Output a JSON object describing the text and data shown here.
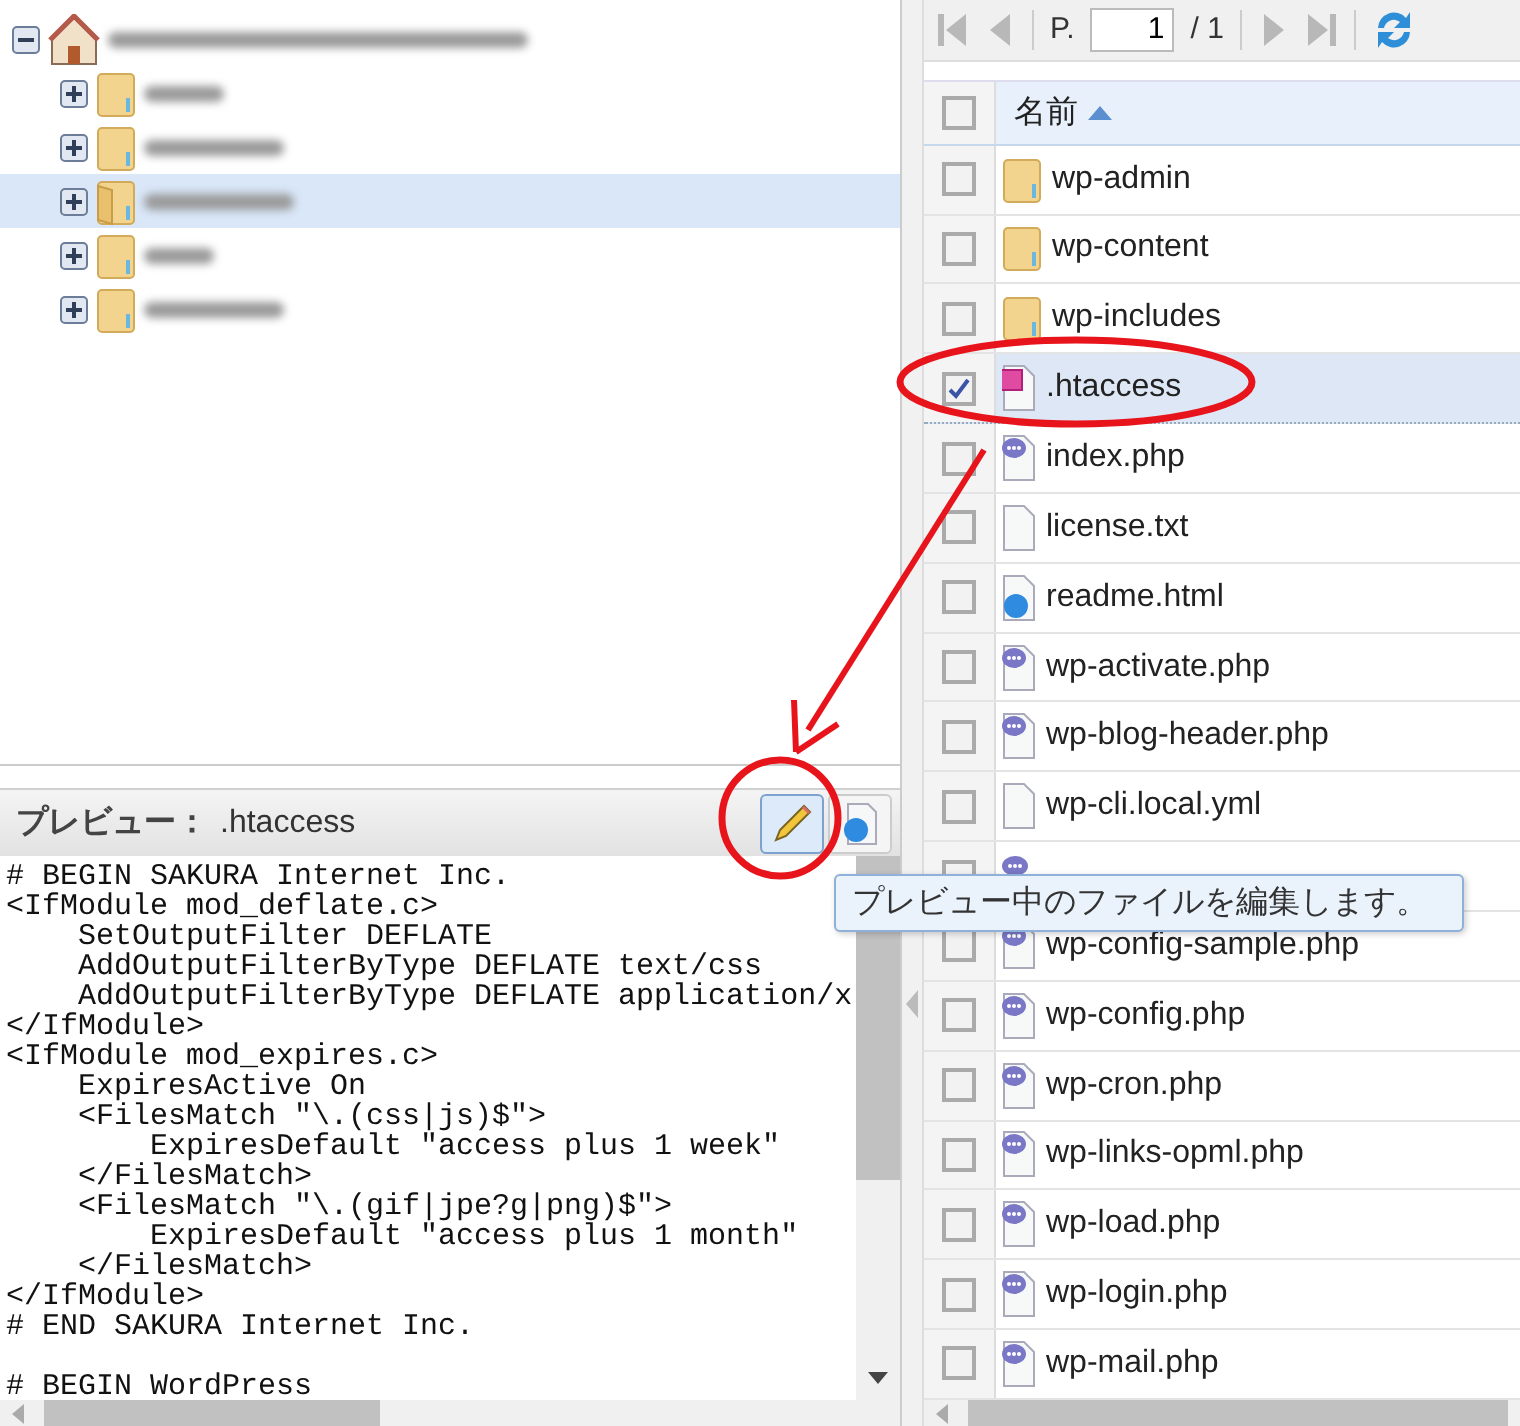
{
  "tree": {
    "root": {
      "expanded": true,
      "children": [
        {
          "expanded": false,
          "selected": false
        },
        {
          "expanded": false,
          "selected": false
        },
        {
          "expanded": false,
          "selected": true
        },
        {
          "expanded": false,
          "selected": false
        },
        {
          "expanded": false,
          "selected": false
        }
      ]
    }
  },
  "preview": {
    "label": "プレビュー：",
    "file": ".htaccess",
    "code_blocks": [
      [
        "# BEGIN SAKURA Internet Inc.",
        "<IfModule mod_deflate.c>",
        "    SetOutputFilter DEFLATE",
        "    AddOutputFilterByType DEFLATE text/css",
        "    AddOutputFilterByType DEFLATE application/x",
        "</IfModule>",
        "<IfModule mod_expires.c>",
        "    ExpiresActive On",
        "    <FilesMatch \"\\.(css|js)$\">",
        "        ExpiresDefault \"access plus 1 week\"",
        "    </FilesMatch>",
        "    <FilesMatch \"\\.(gif|jpe?g|png)$\">",
        "        ExpiresDefault \"access plus 1 month\"",
        "    </FilesMatch>",
        "</IfModule>",
        "# END SAKURA Internet Inc."
      ],
      [
        "# BEGIN WordPress"
      ]
    ]
  },
  "tooltip": "プレビュー中のファイルを編集します。",
  "pager": {
    "prefix": "P.",
    "page": "1",
    "total": "/ 1"
  },
  "list": {
    "header": "名前",
    "select_all": {
      "checked": false
    },
    "files": [
      {
        "name": "wp-admin",
        "kind": "folder",
        "checked": false,
        "selected": false
      },
      {
        "name": "wp-content",
        "kind": "folder",
        "checked": false,
        "selected": false
      },
      {
        "name": "wp-includes",
        "kind": "folder",
        "checked": false,
        "selected": false
      },
      {
        "name": ".htaccess",
        "kind": "htaccess",
        "checked": true,
        "selected": true
      },
      {
        "name": "index.php",
        "kind": "php",
        "checked": false,
        "selected": false
      },
      {
        "name": "license.txt",
        "kind": "text",
        "checked": false,
        "selected": false
      },
      {
        "name": "readme.html",
        "kind": "html",
        "checked": false,
        "selected": false
      },
      {
        "name": "wp-activate.php",
        "kind": "php",
        "checked": false,
        "selected": false
      },
      {
        "name": "wp-blog-header.php",
        "kind": "php",
        "checked": false,
        "selected": false
      },
      {
        "name": "wp-cli.local.yml",
        "kind": "text",
        "checked": false,
        "selected": false
      },
      {
        "kind": "php",
        "selected": false
      },
      {
        "name": "wp-config-sample.php",
        "kind": "php",
        "checked": false,
        "selected": false
      },
      {
        "name": "wp-config.php",
        "kind": "php",
        "checked": false,
        "selected": false
      },
      {
        "name": "wp-cron.php",
        "kind": "php",
        "checked": false,
        "selected": false
      },
      {
        "name": "wp-links-opml.php",
        "kind": "php",
        "checked": false,
        "selected": false
      },
      {
        "name": "wp-load.php",
        "kind": "php",
        "checked": false,
        "selected": false
      },
      {
        "name": "wp-login.php",
        "kind": "php",
        "checked": false,
        "selected": false
      },
      {
        "name": "wp-mail.php",
        "kind": "php",
        "checked": false,
        "selected": false
      }
    ]
  }
}
